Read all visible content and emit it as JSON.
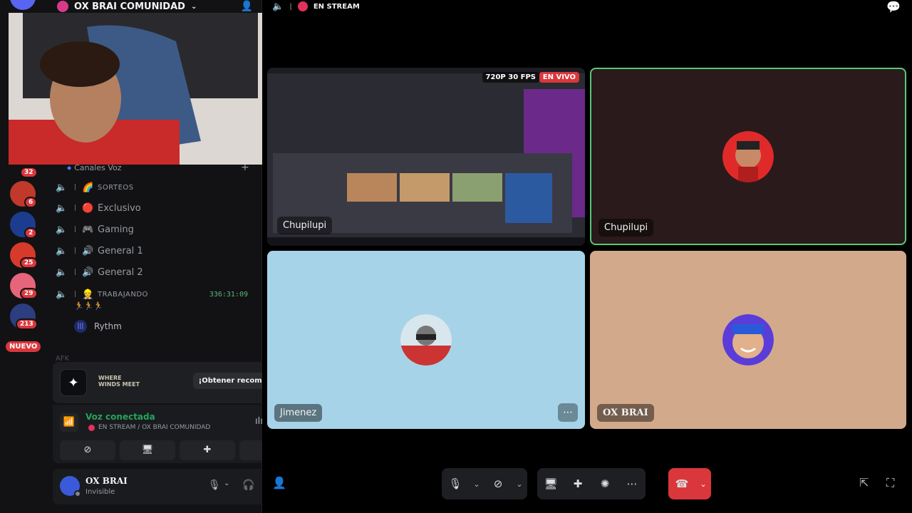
{
  "server": {
    "name": "OX BRAI COMUNIDAD",
    "rail_badges": [
      "32",
      "6",
      "2",
      "25",
      "29",
      "213"
    ],
    "new_label": "NUEVO"
  },
  "sidebar": {
    "category": "Canales Voz",
    "channels": [
      {
        "emoji": "🌈",
        "label": "SORTEOS"
      },
      {
        "emoji": "🔴",
        "label": "Exclusivo"
      },
      {
        "emoji": "🎮",
        "label": "Gaming"
      },
      {
        "emoji": "🔊",
        "label": "General 1"
      },
      {
        "emoji": "🔊",
        "label": "General 2"
      },
      {
        "emoji": "👷",
        "label": "TRABAJANDO",
        "timer": "336:31:09"
      }
    ],
    "voice_user": "Rythm",
    "collapsed_category": "AFK"
  },
  "promo": {
    "game_name": "WHERE WINDS MEET",
    "reward_label": "¡Obtener recompensa!"
  },
  "voice_panel": {
    "title": "Voz conectada",
    "subtitle": "EN STREAM / OX BRAI COMUNIDAD"
  },
  "user_panel": {
    "name": "OX BRAI",
    "presence": "Invisible"
  },
  "topbar": {
    "channel": "EN STREAM"
  },
  "tiles": {
    "stream": {
      "label": "Chupilupi",
      "quality": "720P 30 FPS",
      "live": "EN VIVO"
    },
    "chupilupi": {
      "label": "Chupilupi"
    },
    "jimenez": {
      "label": "Jimenez"
    },
    "oxbrai": {
      "label": "OX BRAI"
    }
  },
  "colors": {
    "accent_green": "#23a55a",
    "danger_red": "#da373c",
    "jimenez_bg": "#a7d3e8",
    "oxbrai_bg": "#d3a98c"
  }
}
